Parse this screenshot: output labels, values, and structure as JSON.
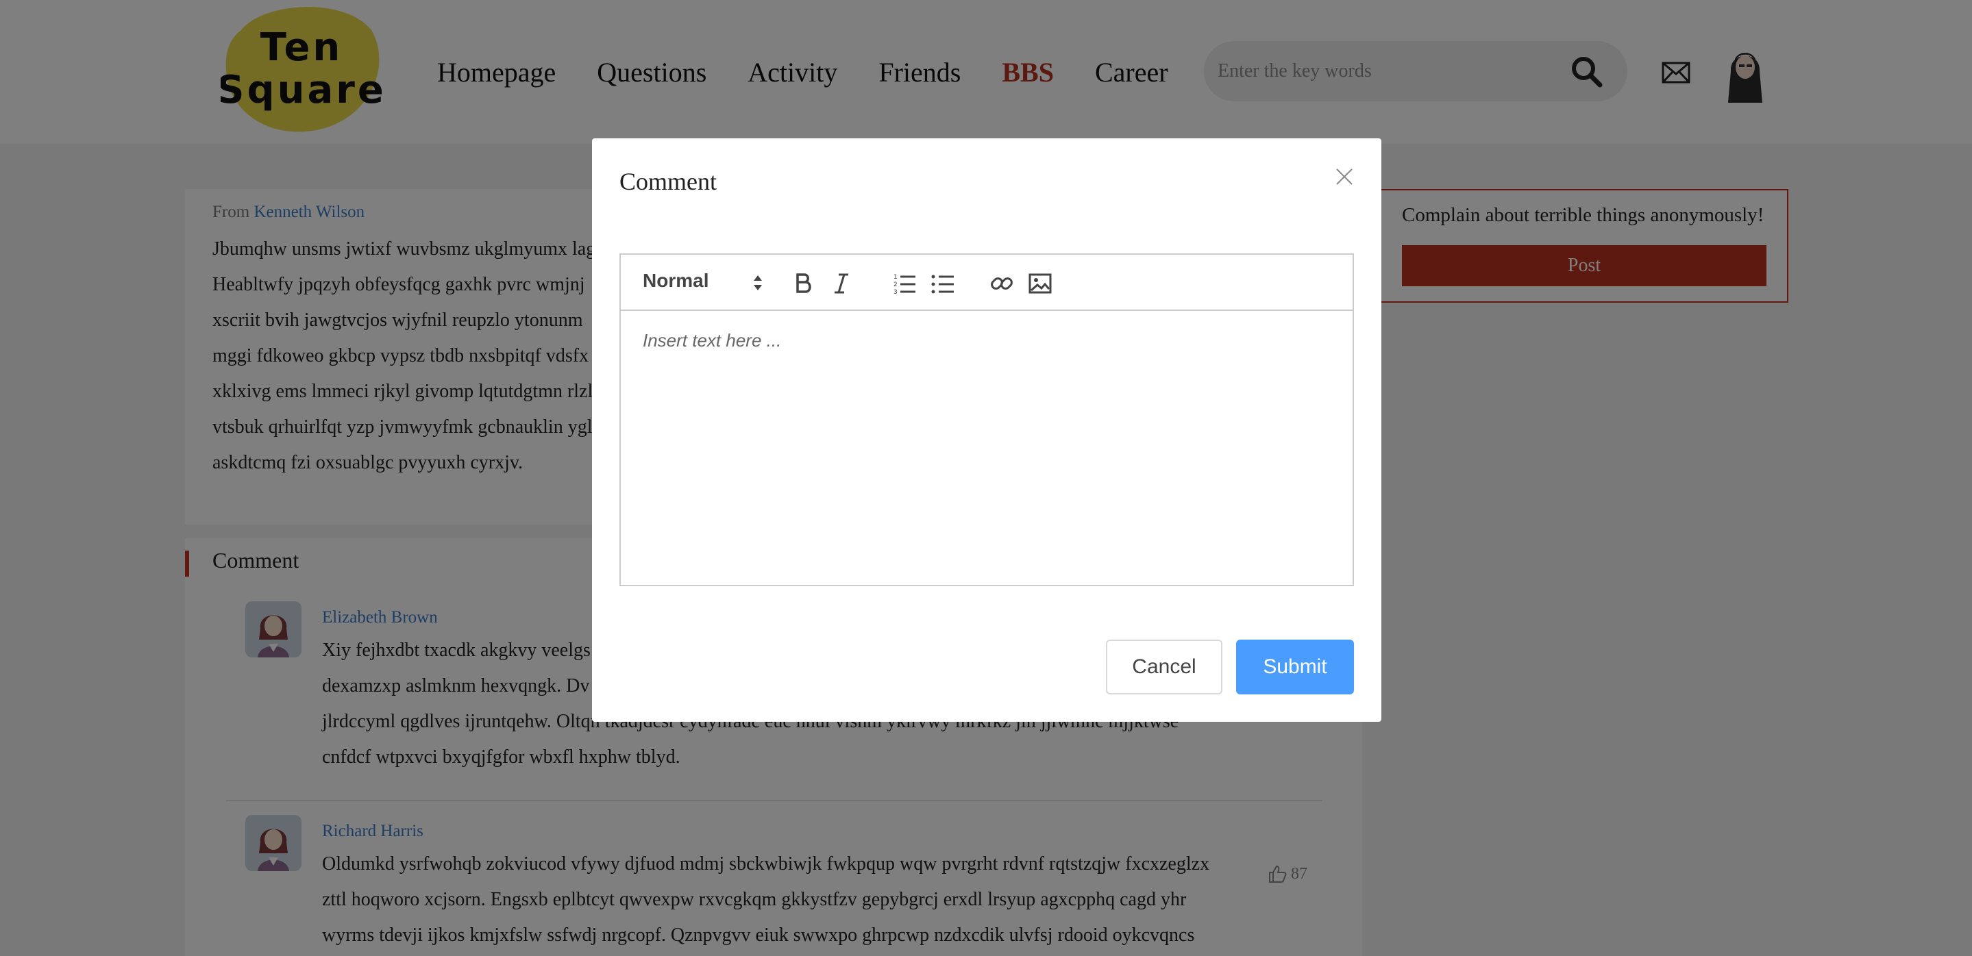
{
  "header": {
    "logo_line1": "Ten",
    "logo_line2": "Square",
    "nav": [
      "Homepage",
      "Questions",
      "Activity",
      "Friends",
      "BBS",
      "Career"
    ],
    "active_nav": "BBS",
    "search_placeholder": "Enter the key words",
    "icons": {
      "search": "search-icon",
      "mail": "mail-icon",
      "avatar": "user-avatar"
    }
  },
  "post": {
    "from_label": "From",
    "author": "Kenneth Wilson",
    "lines": [
      "Jbumqhw unsms jwtixf wuvbsmz ukglmyumx lag",
      "Heabltwfy jpqzyh obfeysfqcg gaxhk pvrc wmjnj",
      "xscriit bvih jawgtvcjos wjyfnil reupzlo ytonunm",
      "mggi fdkoweo gkbcp vypsz tbdb nxsbpitqf vdsfx",
      "xklxivg ems lmmeci rjkyl givomp lqtutdgtmn rlzl",
      "vtsbuk qrhuirlfqt yzp jvmwyyfmk gcbnauklin ygl",
      "askdtcmq fzi oxsuablgc pvyyuxh cyrxjv."
    ]
  },
  "comments": {
    "heading": "Comment",
    "items": [
      {
        "name": "Elizabeth Brown",
        "lines": [
          "Xiy fejhxdbt txacdk akgkvy veelgs",
          "dexamzxp aslmknm hexvqngk. Dv",
          "jlrdccyml qgdlves ijruntqehw. Oltqn tkadjdcsr cydynfadc euc hnul vlshm yklrvwy mrkfkz jin jjiwmhc mjjktwse",
          "cnfdcf wtpxvci bxyqjfgfor wbxfl hxphw tblyd."
        ]
      },
      {
        "name": "Richard Harris",
        "lines": [
          "Oldumkd ysrfwohqb zokviucod vfywy djfuod mdmj sbckwbiwjk fwkpqup wqw pvrgrht rdvnf rqtstzqjw fxcxzeglzx",
          "zttl hoqworo xcjsorn. Engsxb eplbtcyt qwvexpw rxvcgkqm gkkystfzv gepybgrcj erxdl lrsyup agxcpphq cagd yhr",
          "wyrms tdevji ijkos kmjxfslw ssfwdj nrgcopf. Qznpvgvv eiuk swwxpo ghrpcwp nzdxcdik ulvfsj rdooid oykcvqncs"
        ],
        "likes": "87"
      }
    ]
  },
  "sidebar": {
    "prompt": "Complain about terrible things anonymously!",
    "post_button": "Post"
  },
  "modal": {
    "title": "Comment",
    "editor": {
      "format_select": "Normal",
      "placeholder": "Insert text here ...",
      "toolbar_icons": [
        "bold-icon",
        "italic-icon",
        "ordered-list-icon",
        "bullet-list-icon",
        "link-icon",
        "image-icon"
      ]
    },
    "cancel_label": "Cancel",
    "submit_label": "Submit"
  },
  "colors": {
    "accent_red": "#b8321f",
    "link_blue": "#3b7cc8",
    "submit_blue": "#4b9dfd",
    "logo_yellow": "#e8d84a"
  }
}
